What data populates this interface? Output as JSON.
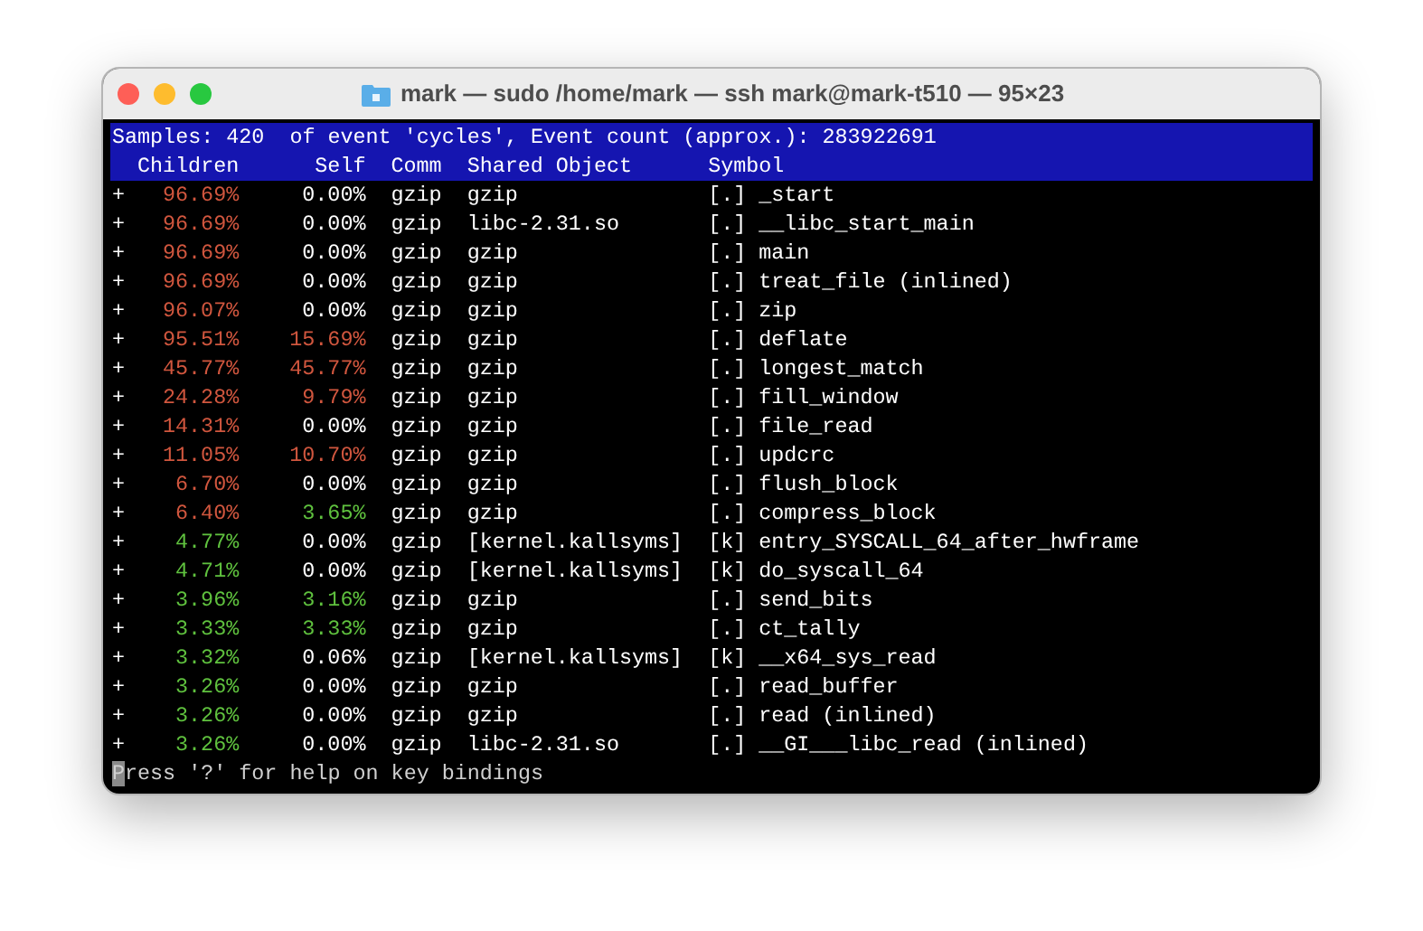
{
  "window": {
    "title": "mark — sudo /home/mark — ssh mark@mark-t510 — 95×23"
  },
  "header": {
    "summary": "Samples: 420  of event 'cycles', Event count (approx.): 283922691",
    "columns": [
      "Children",
      "Self",
      "Comm",
      "Shared Object",
      "Symbol"
    ]
  },
  "rows": [
    {
      "expander": "+",
      "children": {
        "text": "96.69%",
        "color": "#d0563e"
      },
      "self": {
        "text": "0.00%",
        "color": "#ffffff"
      },
      "comm": "gzip",
      "shared_object": "gzip",
      "symbol": "[.] _start"
    },
    {
      "expander": "+",
      "children": {
        "text": "96.69%",
        "color": "#d0563e"
      },
      "self": {
        "text": "0.00%",
        "color": "#ffffff"
      },
      "comm": "gzip",
      "shared_object": "libc-2.31.so",
      "symbol": "[.] __libc_start_main"
    },
    {
      "expander": "+",
      "children": {
        "text": "96.69%",
        "color": "#d0563e"
      },
      "self": {
        "text": "0.00%",
        "color": "#ffffff"
      },
      "comm": "gzip",
      "shared_object": "gzip",
      "symbol": "[.] main"
    },
    {
      "expander": "+",
      "children": {
        "text": "96.69%",
        "color": "#d0563e"
      },
      "self": {
        "text": "0.00%",
        "color": "#ffffff"
      },
      "comm": "gzip",
      "shared_object": "gzip",
      "symbol": "[.] treat_file (inlined)"
    },
    {
      "expander": "+",
      "children": {
        "text": "96.07%",
        "color": "#d0563e"
      },
      "self": {
        "text": "0.00%",
        "color": "#ffffff"
      },
      "comm": "gzip",
      "shared_object": "gzip",
      "symbol": "[.] zip"
    },
    {
      "expander": "+",
      "children": {
        "text": "95.51%",
        "color": "#d0563e"
      },
      "self": {
        "text": "15.69%",
        "color": "#d0563e"
      },
      "comm": "gzip",
      "shared_object": "gzip",
      "symbol": "[.] deflate"
    },
    {
      "expander": "+",
      "children": {
        "text": "45.77%",
        "color": "#d0563e"
      },
      "self": {
        "text": "45.77%",
        "color": "#d0563e"
      },
      "comm": "gzip",
      "shared_object": "gzip",
      "symbol": "[.] longest_match"
    },
    {
      "expander": "+",
      "children": {
        "text": "24.28%",
        "color": "#d0563e"
      },
      "self": {
        "text": "9.79%",
        "color": "#d0563e"
      },
      "comm": "gzip",
      "shared_object": "gzip",
      "symbol": "[.] fill_window"
    },
    {
      "expander": "+",
      "children": {
        "text": "14.31%",
        "color": "#d0563e"
      },
      "self": {
        "text": "0.00%",
        "color": "#ffffff"
      },
      "comm": "gzip",
      "shared_object": "gzip",
      "symbol": "[.] file_read"
    },
    {
      "expander": "+",
      "children": {
        "text": "11.05%",
        "color": "#d0563e"
      },
      "self": {
        "text": "10.70%",
        "color": "#d0563e"
      },
      "comm": "gzip",
      "shared_object": "gzip",
      "symbol": "[.] updcrc"
    },
    {
      "expander": "+",
      "children": {
        "text": "6.70%",
        "color": "#d0563e"
      },
      "self": {
        "text": "0.00%",
        "color": "#ffffff"
      },
      "comm": "gzip",
      "shared_object": "gzip",
      "symbol": "[.] flush_block"
    },
    {
      "expander": "+",
      "children": {
        "text": "6.40%",
        "color": "#d0563e"
      },
      "self": {
        "text": "3.65%",
        "color": "#5fc13e"
      },
      "comm": "gzip",
      "shared_object": "gzip",
      "symbol": "[.] compress_block"
    },
    {
      "expander": "+",
      "children": {
        "text": "4.77%",
        "color": "#5fc13e"
      },
      "self": {
        "text": "0.00%",
        "color": "#ffffff"
      },
      "comm": "gzip",
      "shared_object": "[kernel.kallsyms]",
      "symbol": "[k] entry_SYSCALL_64_after_hwframe"
    },
    {
      "expander": "+",
      "children": {
        "text": "4.71%",
        "color": "#5fc13e"
      },
      "self": {
        "text": "0.00%",
        "color": "#ffffff"
      },
      "comm": "gzip",
      "shared_object": "[kernel.kallsyms]",
      "symbol": "[k] do_syscall_64"
    },
    {
      "expander": "+",
      "children": {
        "text": "3.96%",
        "color": "#5fc13e"
      },
      "self": {
        "text": "3.16%",
        "color": "#5fc13e"
      },
      "comm": "gzip",
      "shared_object": "gzip",
      "symbol": "[.] send_bits"
    },
    {
      "expander": "+",
      "children": {
        "text": "3.33%",
        "color": "#5fc13e"
      },
      "self": {
        "text": "3.33%",
        "color": "#5fc13e"
      },
      "comm": "gzip",
      "shared_object": "gzip",
      "symbol": "[.] ct_tally"
    },
    {
      "expander": "+",
      "children": {
        "text": "3.32%",
        "color": "#5fc13e"
      },
      "self": {
        "text": "0.06%",
        "color": "#ffffff"
      },
      "comm": "gzip",
      "shared_object": "[kernel.kallsyms]",
      "symbol": "[k] __x64_sys_read"
    },
    {
      "expander": "+",
      "children": {
        "text": "3.26%",
        "color": "#5fc13e"
      },
      "self": {
        "text": "0.00%",
        "color": "#ffffff"
      },
      "comm": "gzip",
      "shared_object": "gzip",
      "symbol": "[.] read_buffer"
    },
    {
      "expander": "+",
      "children": {
        "text": "3.26%",
        "color": "#5fc13e"
      },
      "self": {
        "text": "0.00%",
        "color": "#ffffff"
      },
      "comm": "gzip",
      "shared_object": "gzip",
      "symbol": "[.] read (inlined)"
    },
    {
      "expander": "+",
      "children": {
        "text": "3.26%",
        "color": "#5fc13e"
      },
      "self": {
        "text": "0.00%",
        "color": "#ffffff"
      },
      "comm": "gzip",
      "shared_object": "libc-2.31.so",
      "symbol": "[.] __GI___libc_read (inlined)"
    }
  ],
  "status_line": "Press '?' for help on key bindings"
}
